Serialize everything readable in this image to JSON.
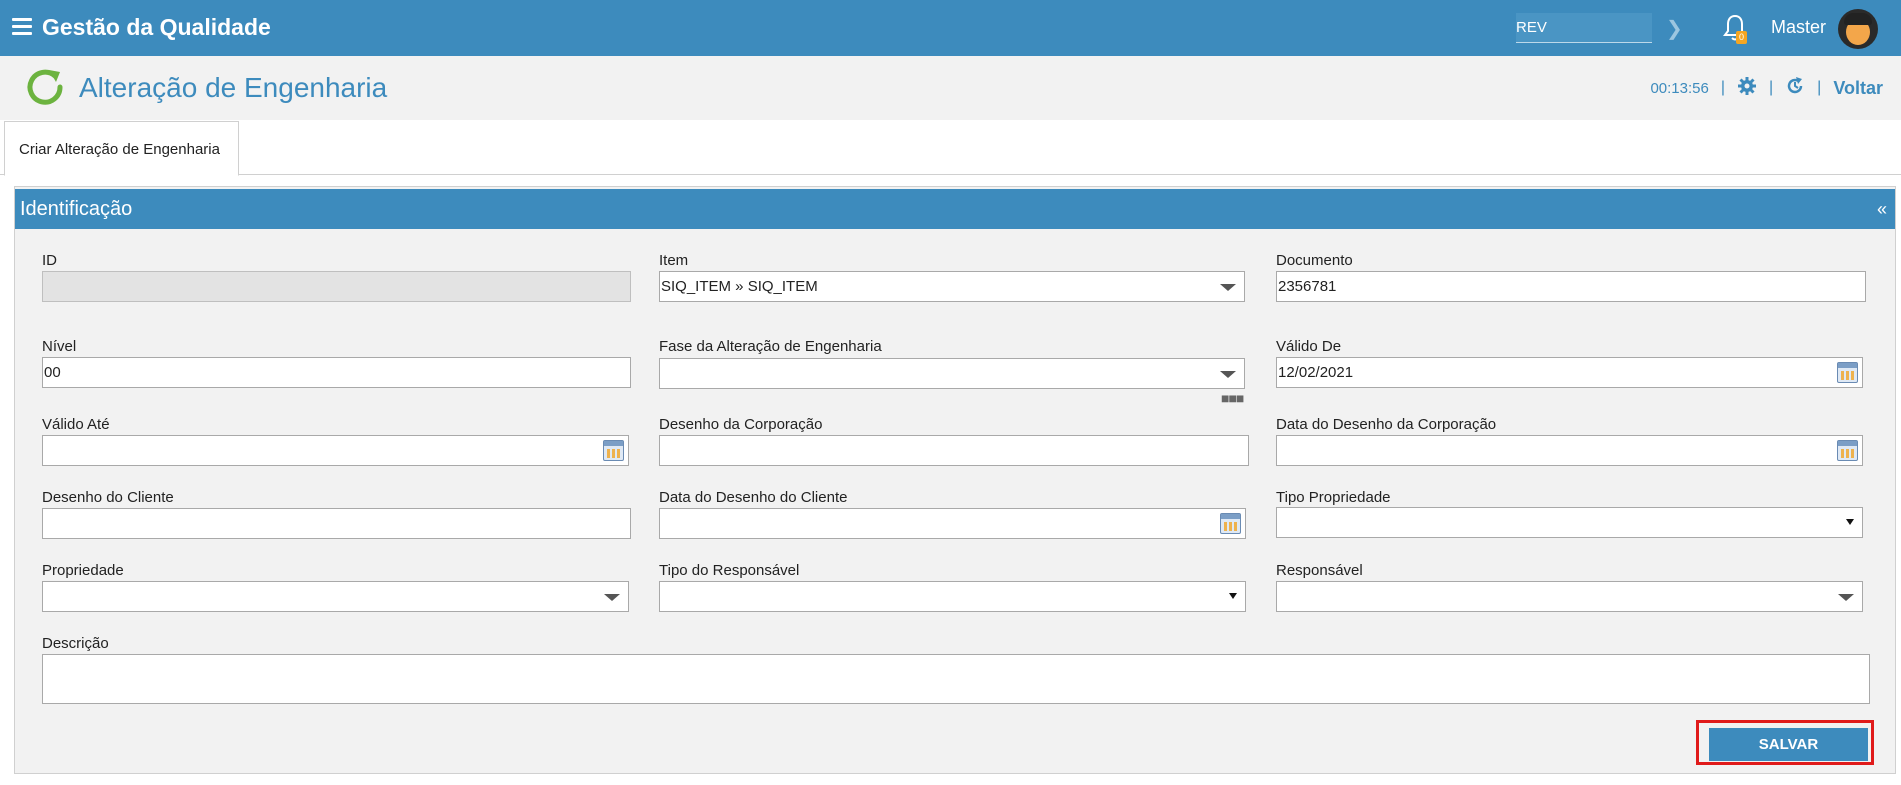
{
  "app": {
    "title": "Gestão da Qualidade"
  },
  "topbar": {
    "rev_value": "REV",
    "notification_count": "0",
    "user_name": "Master"
  },
  "page": {
    "title": "Alteração de Engenharia",
    "timer": "00:13:56",
    "back_label": "Voltar"
  },
  "tabs": [
    {
      "label": "Criar Alteração de Engenharia"
    }
  ],
  "panel": {
    "title": "Identificação",
    "collapse_symbol": "«"
  },
  "form": {
    "id": {
      "label": "ID",
      "value": ""
    },
    "item": {
      "label": "Item",
      "value": "SIQ_ITEM » SIQ_ITEM"
    },
    "documento": {
      "label": "Documento",
      "value": "2356781"
    },
    "nivel": {
      "label": "Nível",
      "value": "00"
    },
    "fase": {
      "label": "Fase da Alteração de Engenharia",
      "value": ""
    },
    "valido_de": {
      "label": "Válido De",
      "value": "12/02/2021"
    },
    "valido_ate": {
      "label": "Válido Até",
      "value": ""
    },
    "desenho_corporacao": {
      "label": "Desenho da Corporação",
      "value": ""
    },
    "data_desenho_corporacao": {
      "label": "Data do Desenho da Corporação",
      "value": ""
    },
    "desenho_cliente": {
      "label": "Desenho do Cliente",
      "value": ""
    },
    "data_desenho_cliente": {
      "label": "Data do Desenho do Cliente",
      "value": ""
    },
    "tipo_propriedade": {
      "label": "Tipo Propriedade",
      "value": ""
    },
    "propriedade": {
      "label": "Propriedade",
      "value": ""
    },
    "tipo_responsavel": {
      "label": "Tipo do Responsável",
      "value": ""
    },
    "responsavel": {
      "label": "Responsável",
      "value": ""
    },
    "descricao": {
      "label": "Descrição",
      "value": ""
    }
  },
  "actions": {
    "save_label": "SALVAR"
  }
}
